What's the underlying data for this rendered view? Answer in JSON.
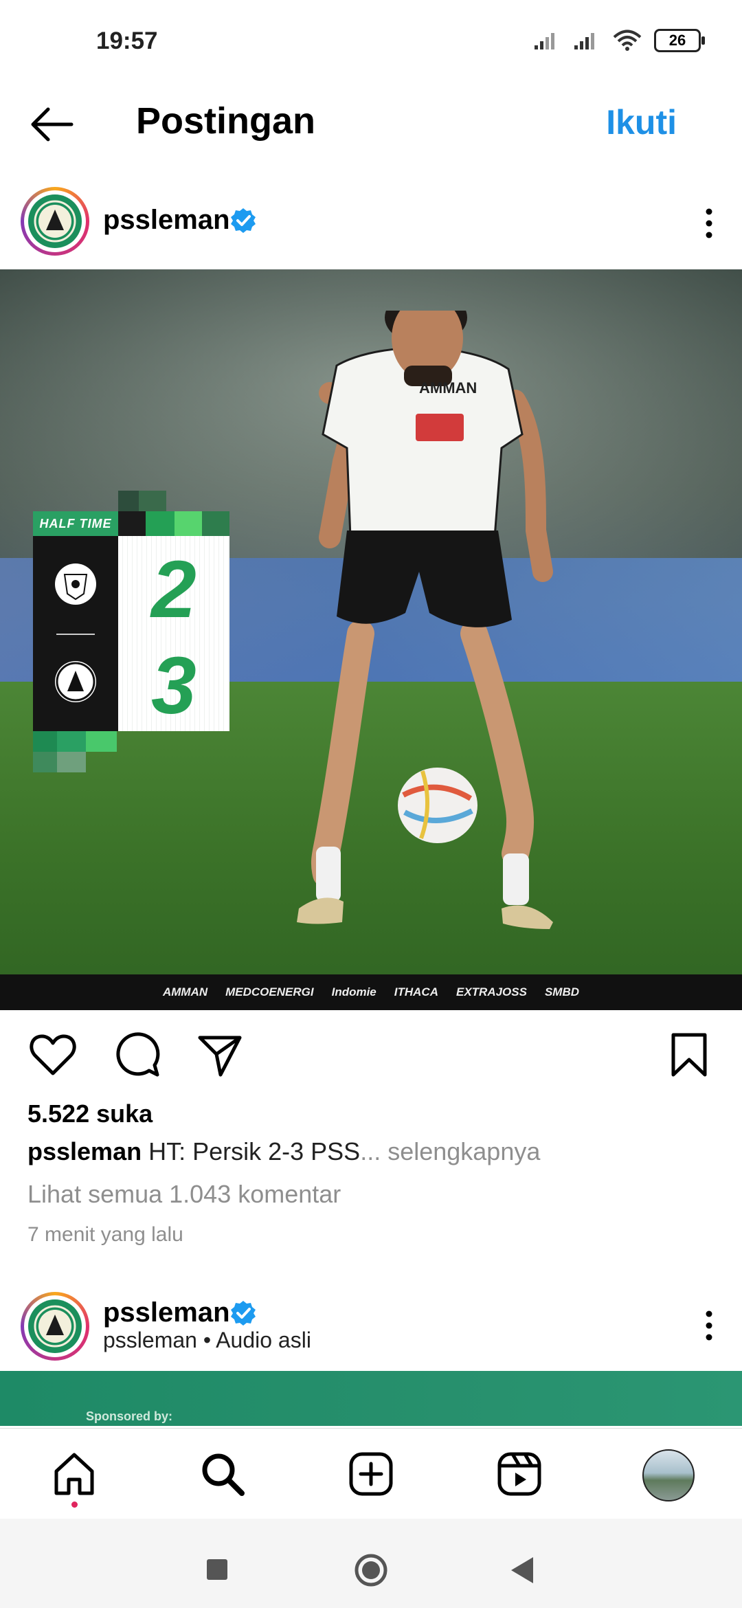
{
  "status_bar": {
    "time": "19:57",
    "battery": "26"
  },
  "header": {
    "title": "Postingan",
    "follow_label": "Ikuti"
  },
  "post": {
    "username": "pssleman",
    "image": {
      "scorecard": {
        "label": "HALF TIME",
        "home_score": "2",
        "away_score": "3"
      },
      "sponsors": [
        "AMMAN",
        "MEDCOENERGI",
        "Indomie",
        "ITHACA",
        "EXTRAJOSS",
        "SMBD"
      ]
    },
    "likes": "5.522 suka",
    "caption_user": "pssleman",
    "caption_text": "HT: Persik 2-3 PSS",
    "caption_more": "... selengkapnya",
    "comments_link": "Lihat semua 1.043 komentar",
    "time_ago": "7 menit yang lalu"
  },
  "next_post": {
    "username": "pssleman",
    "subtitle": "pssleman • Audio asli",
    "sponsored_text": "Sponsored by:"
  },
  "icons": {
    "back": "arrow-left-icon",
    "verified": "verified-badge-icon",
    "more": "more-vertical-icon",
    "like": "heart-icon",
    "comment": "comment-icon",
    "share": "send-icon",
    "save": "bookmark-icon",
    "home": "home-icon",
    "search": "search-icon",
    "create": "plus-square-icon",
    "reels": "reels-icon"
  },
  "colors": {
    "accent": "#1e90e6",
    "verified": "#1d9bf0",
    "scoreGreen": "#24a055"
  }
}
